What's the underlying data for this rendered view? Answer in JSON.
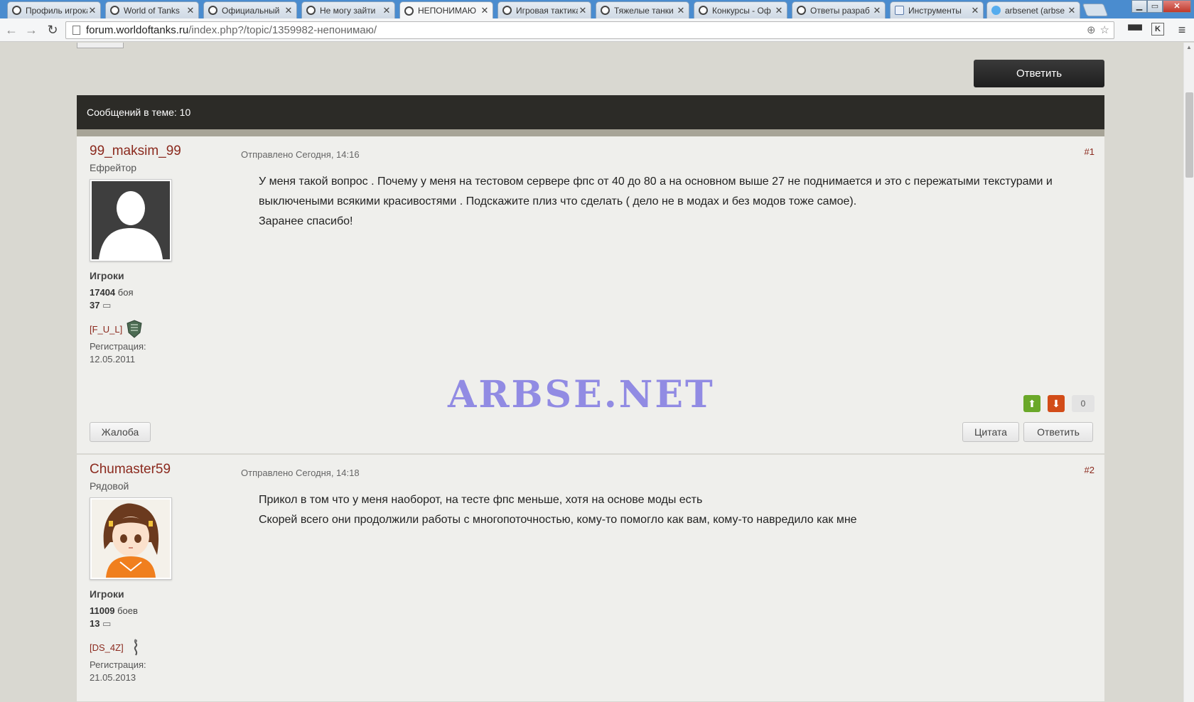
{
  "tabs": [
    {
      "title": "Профиль игрока",
      "icon": "wot"
    },
    {
      "title": "World of Tanks",
      "icon": "wot"
    },
    {
      "title": "Официальный",
      "icon": "wot"
    },
    {
      "title": "Не могу зайти",
      "icon": "wot"
    },
    {
      "title": "НЕПОНИМАЮ",
      "icon": "wot",
      "active": true
    },
    {
      "title": "Игровая тактика",
      "icon": "wot"
    },
    {
      "title": "Тяжелые танки",
      "icon": "wot"
    },
    {
      "title": "Конкурсы - Оф",
      "icon": "wot"
    },
    {
      "title": "Ответы разраб",
      "icon": "wot"
    },
    {
      "title": "Инструменты",
      "icon": "doc"
    },
    {
      "title": "arbsenet (arbse",
      "icon": "twitter"
    }
  ],
  "address": {
    "host": "forum.worldoftanks.ru",
    "path": "/index.php?/topic/1359982-непонимаю/"
  },
  "page": {
    "reply_top_label": "Ответить",
    "thread_header": "Сообщений в теме: 10"
  },
  "posts": [
    {
      "author": "99_maksim_99",
      "rank": "Ефрейтор",
      "group": "Игроки",
      "battles": "17404",
      "battles_label": "боя",
      "posts_count": "37",
      "clan": "[F_U_L]",
      "reg_label": "Регистрация:",
      "reg_date": "12.05.2011",
      "posted": "Отправлено Сегодня, 14:16",
      "number": "#1",
      "lines": [
        "У  меня такой вопрос . Почему у меня на тестовом сервере  фпс  от 40 до 80 а на основном  выше 27 не поднимается  и это  с пережатыми текстурами и  выключеными  всякими красивостями .  Подскажите плиз  что сделать ( дело не в модах  и без модов тоже самое).",
        "Заранее спасибо!"
      ],
      "rep_score": "0",
      "report_label": "Жалоба",
      "quote_label": "Цитата",
      "reply_label": "Ответить"
    },
    {
      "author": "Chumaster59",
      "rank": "Рядовой",
      "group": "Игроки",
      "battles": "11009",
      "battles_label": "боев",
      "posts_count": "13",
      "clan": "[DS_4Z]",
      "reg_label": "Регистрация:",
      "reg_date": "21.05.2013",
      "posted": "Отправлено Сегодня, 14:18",
      "number": "#2",
      "lines": [
        "Прикол в том что у меня наоборот, на тесте фпс меньше, хотя на основе моды есть",
        "Скорей всего они продолжили работы с многопоточностью, кому-то помогло как вам, кому-то навредило как мне"
      ]
    }
  ],
  "watermark": "ARBSE.NET"
}
